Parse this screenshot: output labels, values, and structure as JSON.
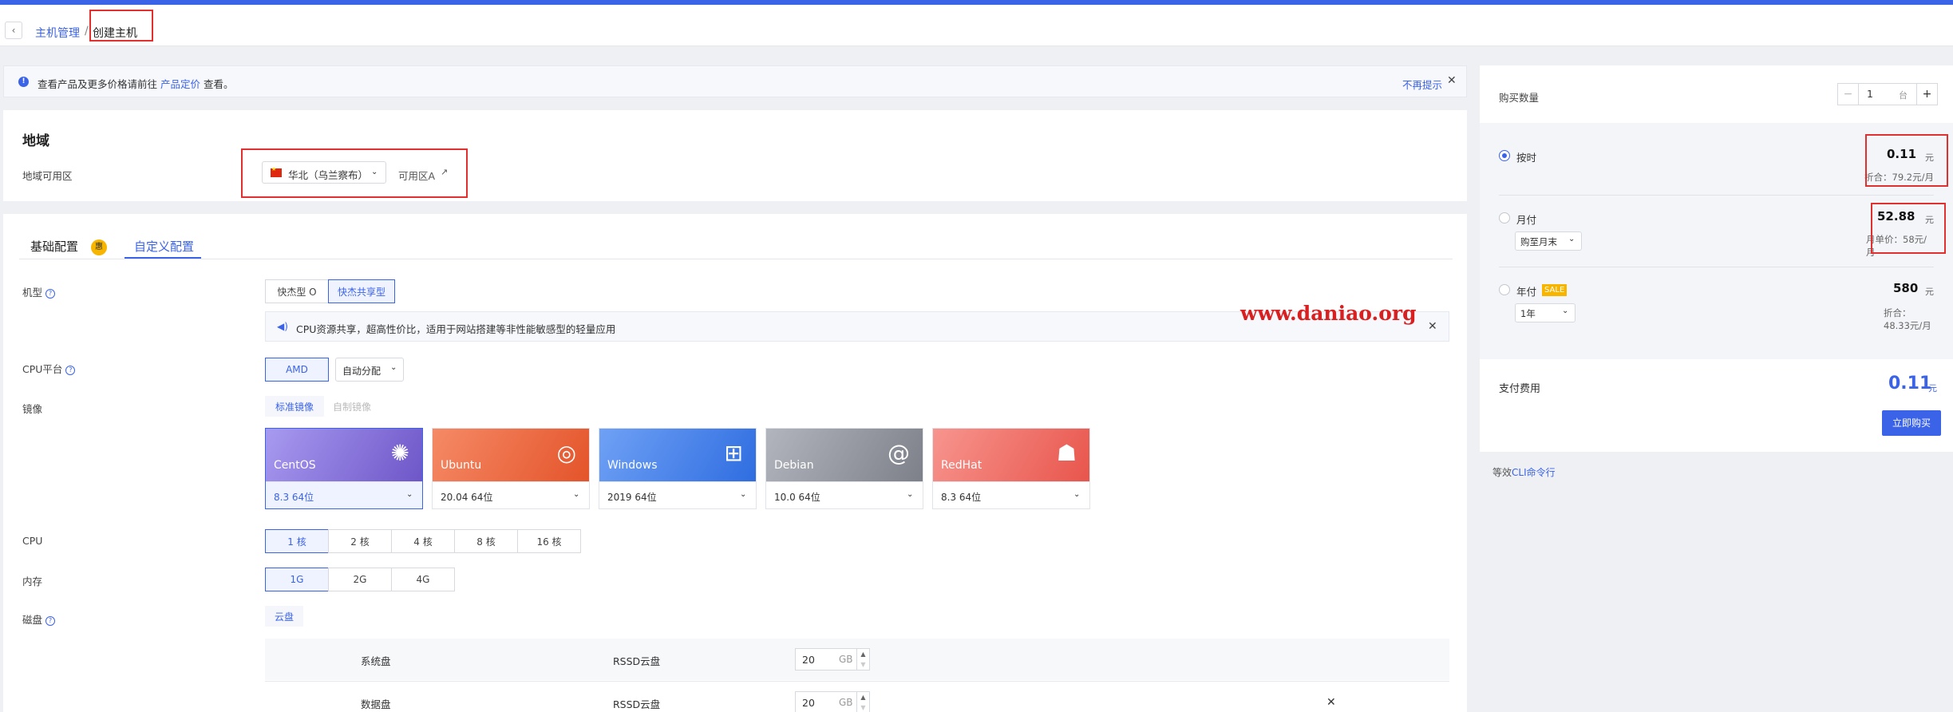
{
  "breadcrumb": {
    "parent": "主机管理",
    "separator": "/",
    "current": "创建主机"
  },
  "notice": {
    "text_before": "查看产品及更多价格请前往 ",
    "link": "产品定价",
    "text_after": " 查看。",
    "dismiss": "不再提示"
  },
  "region": {
    "title": "地域",
    "label": "地域可用区",
    "selected": "华北（乌兰察布）",
    "zone": "可用区A"
  },
  "tabs": [
    {
      "label": "基础配置",
      "badge": "惠"
    },
    {
      "label": "自定义配置"
    }
  ],
  "machine_type": {
    "label": "机型",
    "options": [
      "快杰型 O",
      "快杰共享型"
    ],
    "tip": "CPU资源共享，超高性价比，适用于网站搭建等非性能敏感型的轻量应用"
  },
  "watermark": "www.daniao.org",
  "cpu_platform": {
    "label": "CPU平台",
    "platform": "AMD",
    "allocation": "自动分配"
  },
  "image": {
    "label": "镜像",
    "subtabs": [
      "标准镜像",
      "自制镜像"
    ],
    "os": [
      {
        "name": "CentOS",
        "version": "8.3 64位",
        "color": "#7a66d6"
      },
      {
        "name": "Ubuntu",
        "version": "20.04 64位",
        "color": "#ec6a3e"
      },
      {
        "name": "Windows",
        "version": "2019 64位",
        "color": "#3f7be8"
      },
      {
        "name": "Debian",
        "version": "10.0 64位",
        "color": "#8f929c"
      },
      {
        "name": "RedHat",
        "version": "8.3 64位",
        "color": "#ef6e66"
      }
    ]
  },
  "cpu": {
    "label": "CPU",
    "options": [
      "1 核",
      "2 核",
      "4 核",
      "8 核",
      "16 核"
    ]
  },
  "memory": {
    "label": "内存",
    "options": [
      "1G",
      "2G",
      "4G"
    ]
  },
  "disk": {
    "label": "磁盘",
    "tab": "云盘",
    "rows": [
      {
        "name": "系统盘",
        "type": "RSSD云盘",
        "size": "20",
        "unit": "GB"
      },
      {
        "name": "数据盘",
        "type": "RSSD云盘",
        "size": "20",
        "unit": "GB"
      }
    ]
  },
  "purchase": {
    "qty_label": "购买数量",
    "qty": "1",
    "qty_unit": "台",
    "plans": [
      {
        "name": "按时",
        "price": "0.11",
        "unit": "元",
        "sub": "折合：79.2元/月"
      },
      {
        "name": "月付",
        "price": "52.88",
        "unit": "元",
        "sub": "月单价：58元/月",
        "select": "购至月末"
      },
      {
        "name": "年付",
        "badge": "SALE",
        "price": "580",
        "unit": "元",
        "sub": "折合：48.33元/月",
        "select": "1年"
      }
    ],
    "pay_label": "支付费用",
    "pay_price": "0.11",
    "pay_unit": "元",
    "buy_button": "立即购买"
  },
  "cli": {
    "prefix": "等效",
    "link": "CLI命令行"
  }
}
